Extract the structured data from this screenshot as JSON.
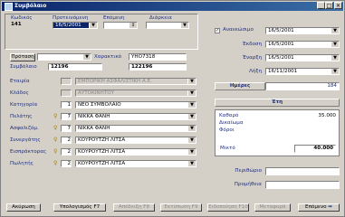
{
  "window": {
    "title": "Συμβόλαιο",
    "controls": {
      "minimize": "_",
      "maximize": "□",
      "close": "✕"
    }
  },
  "header": {
    "kodikos_label": "Κωδικός",
    "kodikos_value": "141",
    "proteinomeni_label": "Προτεινόμενη",
    "proteinomeni_value": "16/5/2001",
    "epomeni_label": "Επόμενη",
    "epomeni_value": "",
    "diarkeia_label": "Διάρκεια",
    "diarkeia_value": ""
  },
  "row_protasi": {
    "button_label": "Πρόταση",
    "value": "",
    "xaraktiko_label": "Χαρακτικό",
    "xaraktiko_value": "YHO7318"
  },
  "row_symvolaio": {
    "label": "Συμβόλαιο",
    "value1": "12196",
    "value2": "122196"
  },
  "left_fields": [
    {
      "label": "Εταιρία",
      "code": "",
      "value": "ΕΜΠΟΡΙΚΗ ΑΣΦΑΛΙΣΤΙΚΗ Α.Ε.",
      "disabled": true,
      "bulb": false
    },
    {
      "label": "Κλάδος",
      "code": "",
      "value": "ΑΥΤΟΚΙΝΗΤΟΥ",
      "disabled": true,
      "bulb": false
    },
    {
      "label": "Κατηγορία",
      "code": "1",
      "value": "ΝΕΟ ΣΥΜΒΟΛΑΙΟ",
      "disabled": false,
      "bulb": false
    },
    {
      "label": "Πελάτης",
      "code": "7",
      "value": "ΝΙΚΚΑ ΦΑΝΗ",
      "disabled": false,
      "bulb": true
    },
    {
      "label": "Ασφαλιζόμ.",
      "code": "7",
      "value": "ΝΙΚΚΑ ΦΑΝΗ",
      "disabled": false,
      "bulb": true
    },
    {
      "label": "Συνεργάτης",
      "code": "2",
      "value": "ΚΟΥΡΟΥΤΖΗ ΛΙΤΣΑ",
      "disabled": false,
      "bulb": true
    },
    {
      "label": "Εισπράκτορας",
      "code": "2",
      "value": "ΚΟΥΡΟΥΤΖΗ ΛΙΤΣΑ",
      "disabled": false,
      "bulb": true
    },
    {
      "label": "Πωλητής",
      "code": "2",
      "value": "ΚΟΥΡΟΥΤΖΗ ΛΙΤΣΑ",
      "disabled": false,
      "bulb": true
    }
  ],
  "dates": {
    "ananeosimo_label": "Ανανεώσιμο",
    "ananeosimo_checked": "✓",
    "ananeosimo_value": "16/5/2001",
    "ekdosi_label": "Έκδοση",
    "ekdosi_value": "16/5/2001",
    "enarxi_label": "Έναρξη",
    "enarxi_value": "16/5/2001",
    "lixi_label": "Λήξη",
    "lixi_value": "16/11/2001"
  },
  "imeres": {
    "label": "Ημέρες",
    "value": "184"
  },
  "eti": {
    "label": "Έτη"
  },
  "premiums": {
    "katharo_label": "Καθαρό",
    "katharo_value": "35.000",
    "dikaiomata_label": "Δικαίωμα",
    "foroi_label": "Φόροι",
    "mikto_label": "Μικτό",
    "mikto_value": "40.000"
  },
  "right_bottom": {
    "perigrafi_label": "Περιθώριο",
    "promitheia_label": "Προμήθεια"
  },
  "buttons": {
    "akyrosi": "Ακύρωση",
    "ypologismos": "Υπολογισμός F7",
    "b3": "Απόδειξη F8",
    "b4": "Εκτύπωση F9",
    "b5": "Ειδοποίηση F10",
    "b6": "Μεταφορά",
    "next": "Επόμενο"
  },
  "colors": {
    "title_bar": "#0a246a",
    "face": "#d4d0c8",
    "label_blue": "#1f2f80",
    "selection": "#0a246a"
  }
}
